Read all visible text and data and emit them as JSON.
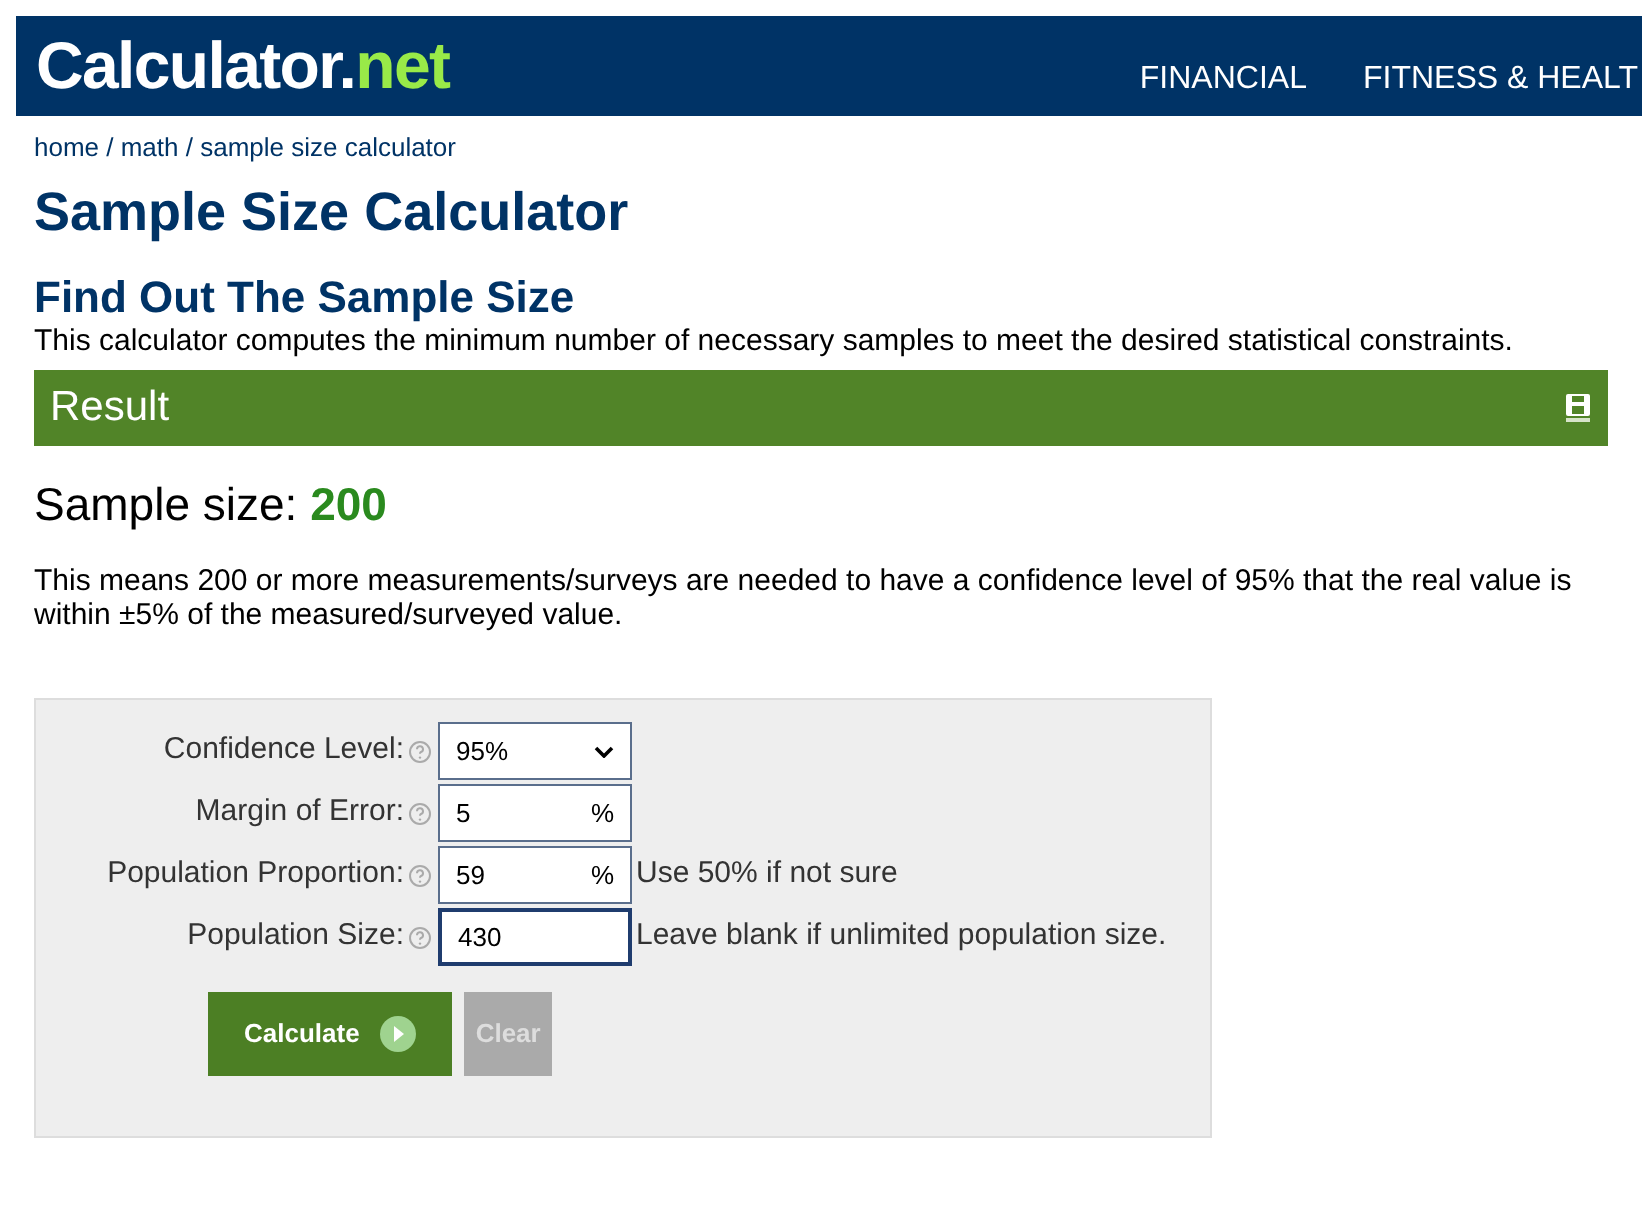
{
  "header": {
    "logo_main": "Calculator.",
    "logo_accent": "net",
    "nav": [
      "FINANCIAL",
      "FITNESS & HEALT"
    ]
  },
  "breadcrumb": "home / math / sample size calculator",
  "title": "Sample Size Calculator",
  "subtitle": "Find Out The Sample Size",
  "description": "This calculator computes the minimum number of necessary samples to meet the desired statistical constraints.",
  "result": {
    "heading": "Result",
    "label": "Sample size: ",
    "value": "200",
    "explanation": "This means 200 or more measurements/surveys are needed to have a confidence level of 95% that the real value is within ±5% of the measured/surveyed value."
  },
  "form": {
    "fields": [
      {
        "kind": "select",
        "label": "Confidence Level:",
        "value": "95%"
      },
      {
        "kind": "percent",
        "label": "Margin of Error:",
        "value": "5",
        "unit": "%"
      },
      {
        "kind": "percent",
        "label": "Population Proportion:",
        "value": "59",
        "unit": "%",
        "hint": "Use 50% if not sure"
      },
      {
        "kind": "text",
        "label": "Population Size:",
        "value": "430",
        "hint": "Leave blank if unlimited population size."
      }
    ],
    "buttons": [
      {
        "kind": "primary",
        "label": "Calculate"
      },
      {
        "kind": "secondary",
        "label": "Clear"
      }
    ]
  }
}
